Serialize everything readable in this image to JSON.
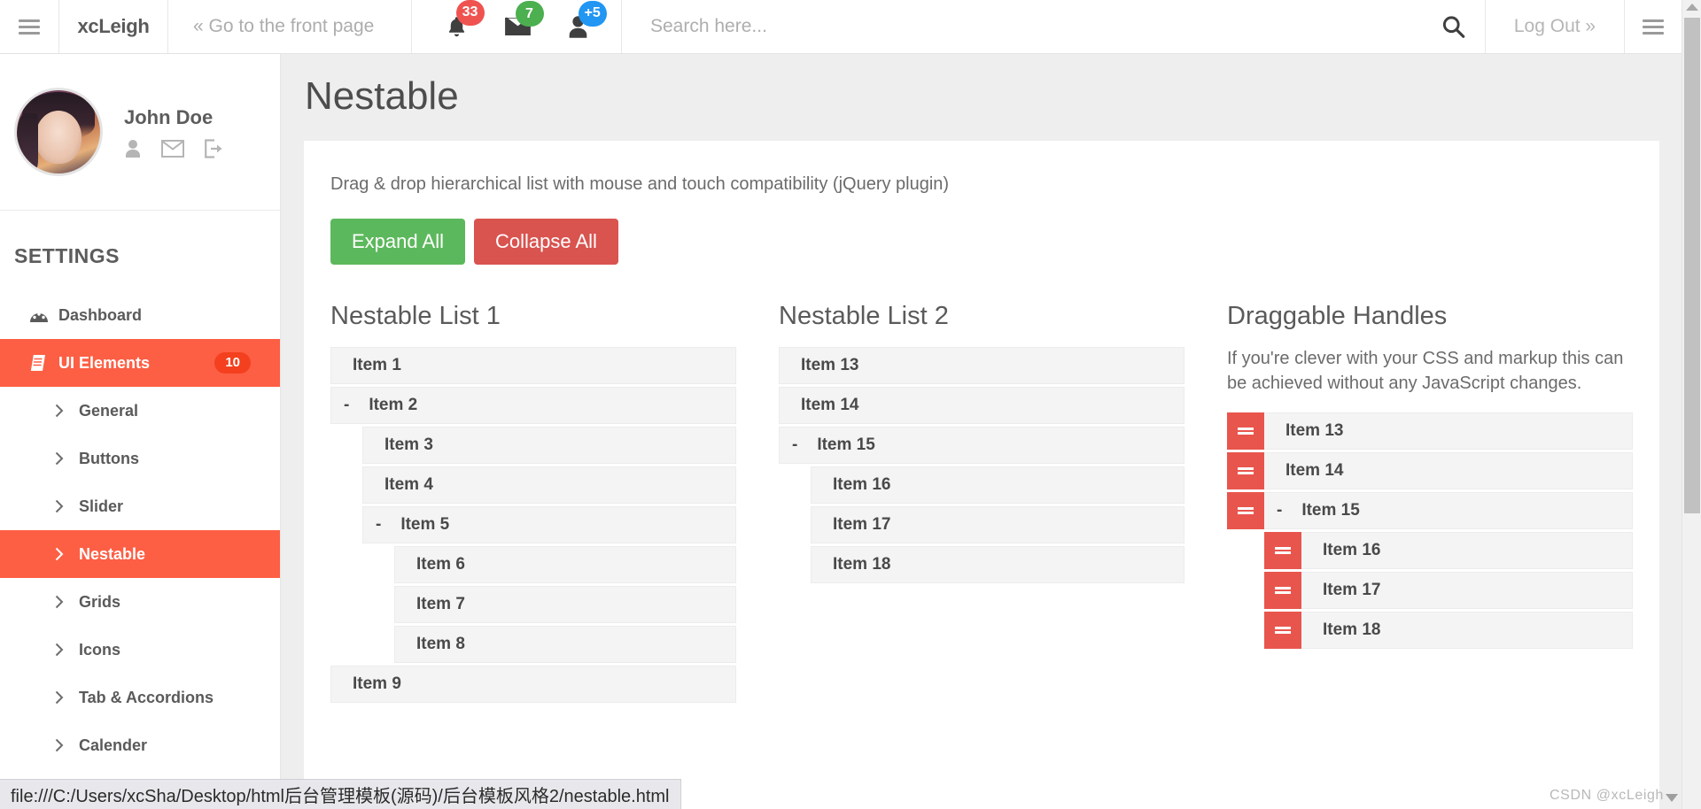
{
  "topbar": {
    "menu_icon": "hamburger-icon",
    "brand": "xcLeigh",
    "front_page_link": "« Go to the front page",
    "notifications": {
      "icon": "bell-icon",
      "count": "33",
      "color": "#ef5350"
    },
    "messages": {
      "icon": "envelope-icon",
      "count": "7",
      "color": "#4caf50"
    },
    "users": {
      "icon": "user-icon",
      "count": "+5",
      "color": "#2196f3"
    },
    "search": {
      "placeholder": "Search here...",
      "value": "",
      "icon": "search-icon"
    },
    "logout": "Log Out »",
    "right_menu_icon": "hamburger-icon"
  },
  "sidebar": {
    "profile": {
      "name": "John Doe",
      "avatar": "user-avatar",
      "actions": [
        {
          "name": "profile-icon",
          "label": "Profile"
        },
        {
          "name": "mail-icon",
          "label": "Messages"
        },
        {
          "name": "logout-icon",
          "label": "Log out"
        }
      ]
    },
    "section_label": "SETTINGS",
    "items": [
      {
        "label": "Dashboard",
        "icon": "dashboard-icon",
        "active": false,
        "badge": ""
      },
      {
        "label": "UI Elements",
        "icon": "book-icon",
        "active": true,
        "badge": "10"
      }
    ],
    "subitems": [
      {
        "label": "General",
        "active": false
      },
      {
        "label": "Buttons",
        "active": false
      },
      {
        "label": "Slider",
        "active": false
      },
      {
        "label": "Nestable",
        "active": true
      },
      {
        "label": "Grids",
        "active": false
      },
      {
        "label": "Icons",
        "active": false
      },
      {
        "label": "Tab & Accordions",
        "active": false
      },
      {
        "label": "Calender",
        "active": false
      }
    ]
  },
  "main": {
    "page_title": "Nestable",
    "description": "Drag & drop hierarchical list with mouse and touch compatibility (jQuery plugin)",
    "buttons": {
      "expand_all": "Expand All",
      "collapse_all": "Collapse All",
      "expand_color": "#5cb85c",
      "collapse_color": "#d9534f"
    },
    "list1": {
      "title": "Nestable List 1",
      "items": [
        {
          "label": "Item 1",
          "collapse": "",
          "children": []
        },
        {
          "label": "Item 2",
          "collapse": "-",
          "children": [
            {
              "label": "Item 3",
              "collapse": "",
              "children": []
            },
            {
              "label": "Item 4",
              "collapse": "",
              "children": []
            },
            {
              "label": "Item 5",
              "collapse": "-",
              "children": [
                {
                  "label": "Item 6",
                  "collapse": "",
                  "children": []
                },
                {
                  "label": "Item 7",
                  "collapse": "",
                  "children": []
                },
                {
                  "label": "Item 8",
                  "collapse": "",
                  "children": []
                }
              ]
            }
          ]
        },
        {
          "label": "Item 9",
          "collapse": "",
          "children": []
        }
      ]
    },
    "list2": {
      "title": "Nestable List 2",
      "items": [
        {
          "label": "Item 13",
          "collapse": "",
          "children": []
        },
        {
          "label": "Item 14",
          "collapse": "",
          "children": []
        },
        {
          "label": "Item 15",
          "collapse": "-",
          "children": [
            {
              "label": "Item 16",
              "collapse": "",
              "children": []
            },
            {
              "label": "Item 17",
              "collapse": "",
              "children": []
            },
            {
              "label": "Item 18",
              "collapse": "",
              "children": []
            }
          ]
        }
      ]
    },
    "handles": {
      "title": "Draggable Handles",
      "note": "If you're clever with your CSS and markup this can be achieved without any JavaScript changes.",
      "handle_color": "#e8554d",
      "items": [
        {
          "label": "Item 13",
          "collapse": "",
          "children": []
        },
        {
          "label": "Item 14",
          "collapse": "",
          "children": []
        },
        {
          "label": "Item 15",
          "collapse": "-",
          "children": [
            {
              "label": "Item 16",
              "collapse": "",
              "children": []
            },
            {
              "label": "Item 17",
              "collapse": "",
              "children": []
            },
            {
              "label": "Item 18",
              "collapse": "",
              "children": []
            }
          ]
        }
      ]
    }
  },
  "statusbar": {
    "url": "file:///C:/Users/xcSha/Desktop/html后台管理模板(源码)/后台模板风格2/nestable.html"
  },
  "watermark": {
    "text": "CSDN @xcLeigh"
  }
}
